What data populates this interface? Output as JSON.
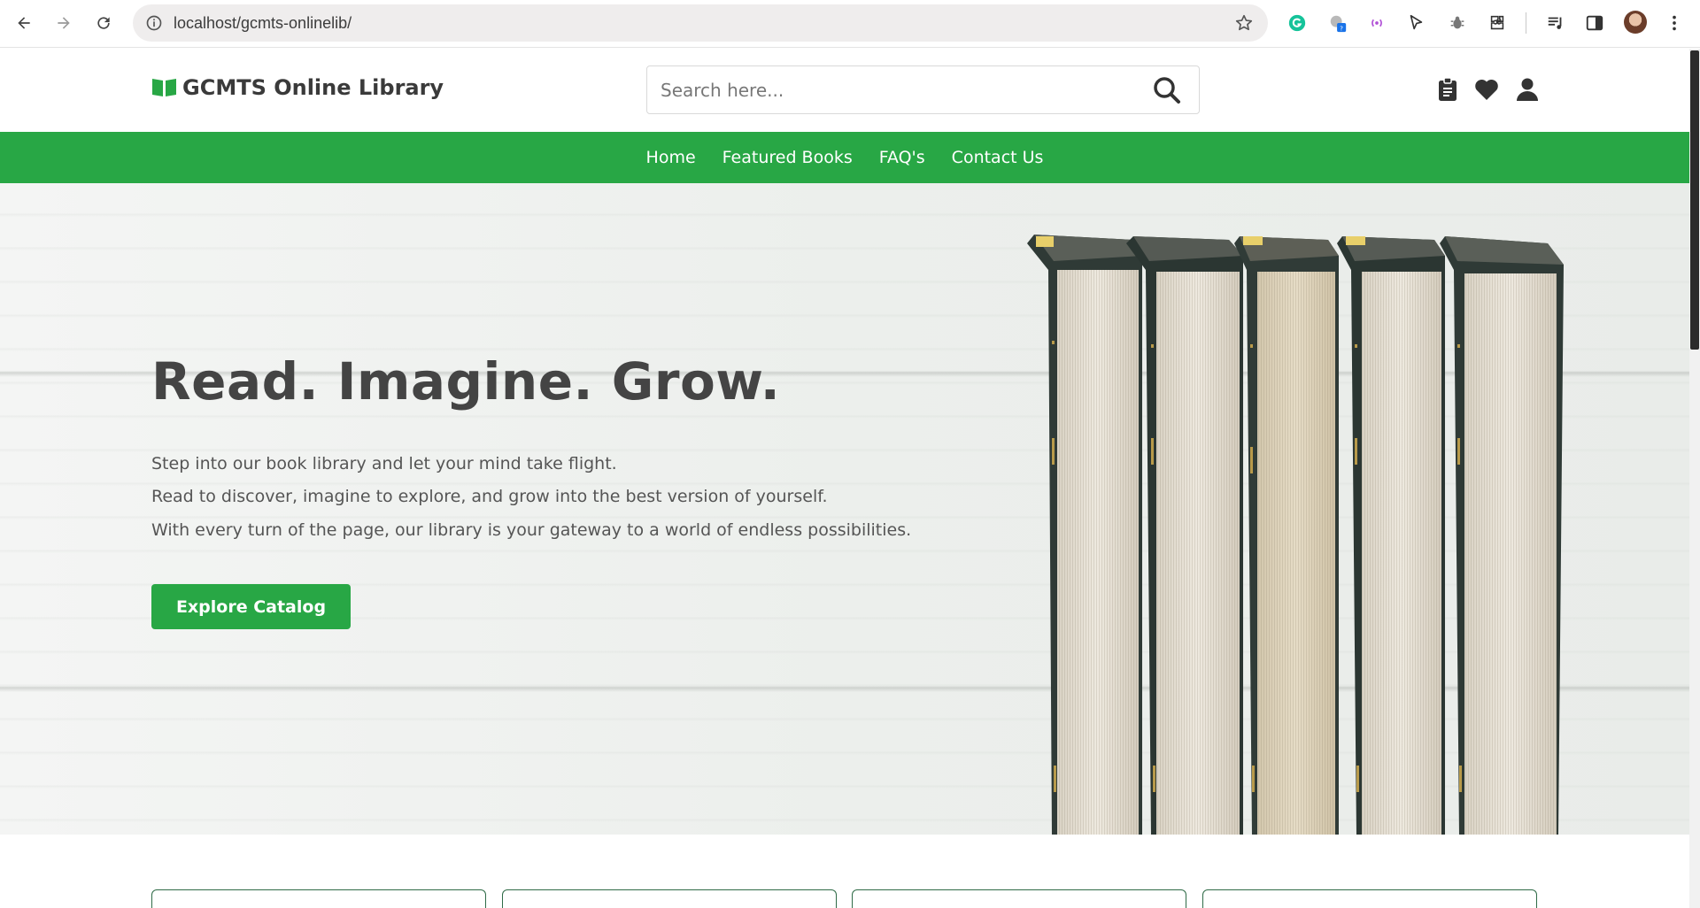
{
  "browser": {
    "url": "localhost/gcmts-onlinelib/"
  },
  "site": {
    "logo_text": "GCMTS Online Library",
    "search_placeholder": "Search here...",
    "nav": [
      "Home",
      "Featured Books",
      "FAQ's",
      "Contact Us"
    ],
    "accent_color": "#28a745"
  },
  "hero": {
    "title": "Read. Imagine. Grow.",
    "lines": [
      "Step into our book library and let your mind take flight.",
      "Read to discover, imagine to explore, and grow into the best version of yourself.",
      "With every turn of the page, our library is your gateway to a world of endless possibilities."
    ],
    "cta_label": "Explore Catalog"
  },
  "icons": {
    "header": [
      "clipboard-icon",
      "heart-icon",
      "user-icon"
    ],
    "logo": "book-open-icon",
    "search": "search-icon"
  }
}
